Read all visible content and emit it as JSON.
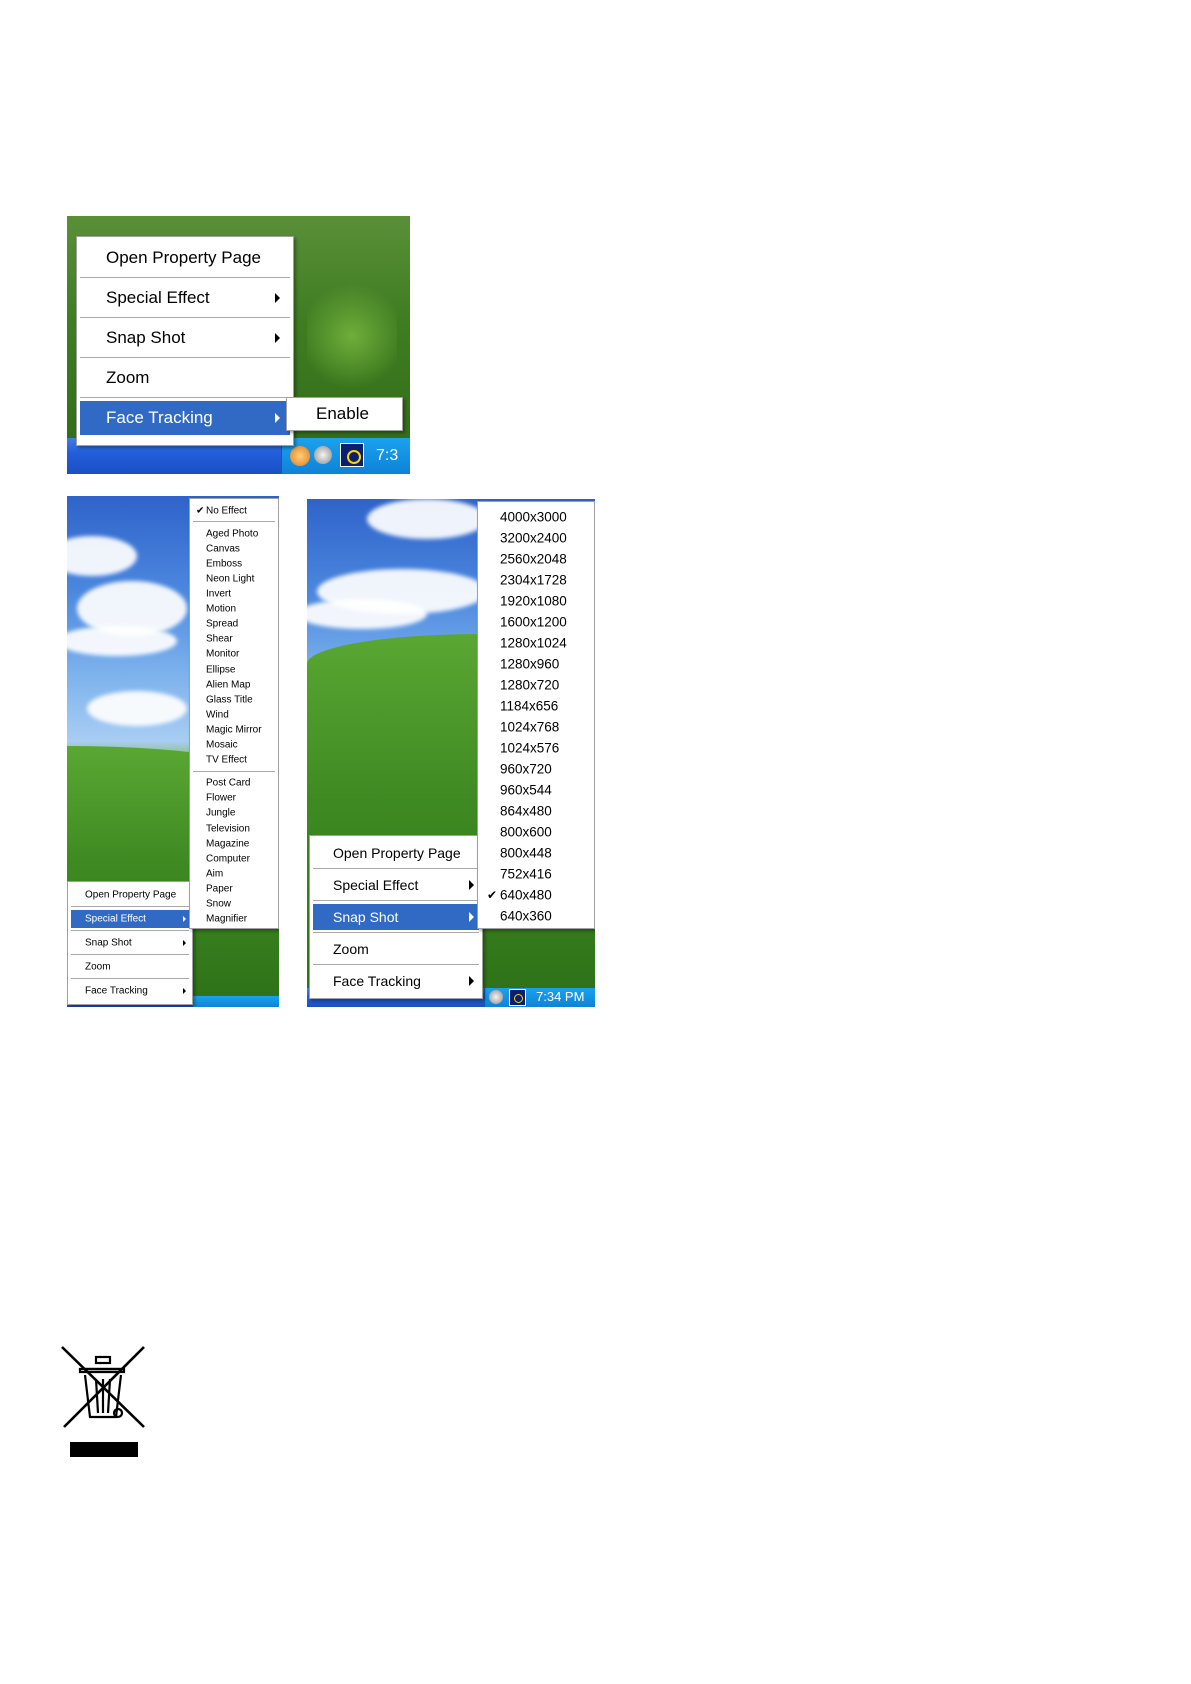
{
  "shot1": {
    "menu": [
      {
        "label": "Open Property Page"
      },
      {
        "label": "Special Effect",
        "submenu": true
      },
      {
        "label": "Snap Shot",
        "submenu": true
      },
      {
        "label": "Zoom"
      },
      {
        "label": "Face Tracking",
        "submenu": true,
        "highlighted": true
      }
    ],
    "submenu": {
      "label": "Enable"
    },
    "clock": "7:3"
  },
  "shot2": {
    "menu": [
      {
        "label": "Open Property Page"
      },
      {
        "label": "Special Effect",
        "submenu": true,
        "highlighted": true
      },
      {
        "label": "Snap Shot",
        "submenu": true
      },
      {
        "label": "Zoom"
      },
      {
        "label": "Face Tracking",
        "submenu": true
      }
    ],
    "effects_checked": "No Effect",
    "effects_group1": [
      "Aged Photo",
      "Canvas",
      "Emboss",
      "Neon Light",
      "Invert",
      "Motion",
      "Spread",
      "Shear",
      "Monitor",
      "Ellipse",
      "Alien Map",
      "Glass Title",
      "Wind",
      "Magic Mirror",
      "Mosaic",
      "TV Effect"
    ],
    "effects_group2": [
      "Post Card",
      "Flower",
      "Jungle",
      "Television",
      "Magazine",
      "Computer",
      "Aim",
      "Paper",
      "Snow",
      "Magnifier"
    ]
  },
  "shot3": {
    "menu": [
      {
        "label": "Open Property Page"
      },
      {
        "label": "Special Effect",
        "submenu": true
      },
      {
        "label": "Snap Shot",
        "submenu": true,
        "highlighted": true
      },
      {
        "label": "Zoom"
      },
      {
        "label": "Face Tracking",
        "submenu": true
      }
    ],
    "resolutions": [
      "4000x3000",
      "3200x2400",
      "2560x2048",
      "2304x1728",
      "1920x1080",
      "1600x1200",
      "1280x1024",
      "1280x960",
      "1280x720",
      "1184x656",
      "1024x768",
      "1024x576",
      "960x720",
      "960x544",
      "864x480",
      "800x600",
      "800x448",
      "752x416",
      "640x480",
      "640x360"
    ],
    "checked_resolution": "640x480",
    "clock": "7:34 PM"
  },
  "icons": [
    "speaker-icon",
    "network-icon",
    "camera-tray-icon",
    "checkmark-icon",
    "submenu-arrow-icon",
    "weee-crossed-bin-icon"
  ]
}
